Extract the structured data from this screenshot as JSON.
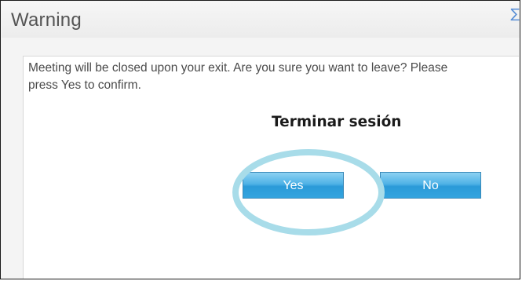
{
  "dialog": {
    "title": "Warning",
    "message": "Meeting will be closed upon your exit. Are you sure you want to leave? Please press Yes to confirm.",
    "annotation": "Terminar sesión",
    "buttons": {
      "yes_label": "Yes",
      "no_label": "No"
    },
    "close_icon": "close-icon",
    "colors": {
      "button_top": "#8dd1f2",
      "button_bottom": "#2a9ad8",
      "highlight_ring": "#a8dce9",
      "title_text": "#555555",
      "close_icon": "#5a8fd6"
    }
  }
}
